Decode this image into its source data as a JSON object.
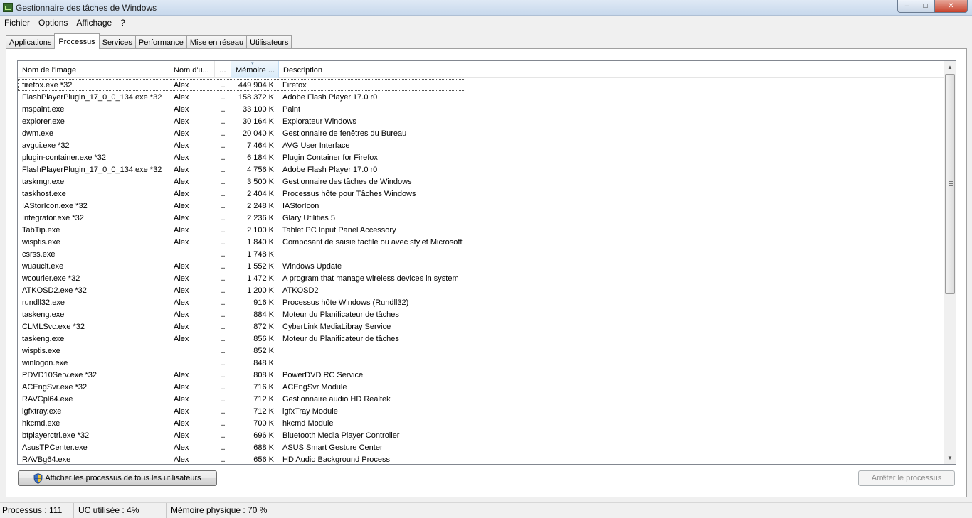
{
  "window": {
    "title": "Gestionnaire des tâches de Windows",
    "controls": {
      "minimize": "–",
      "maximize": "□",
      "close": "✕"
    }
  },
  "menu": [
    "Fichier",
    "Options",
    "Affichage",
    "?"
  ],
  "tabs": [
    {
      "label": "Applications",
      "active": false
    },
    {
      "label": "Processus",
      "active": true
    },
    {
      "label": "Services",
      "active": false
    },
    {
      "label": "Performance",
      "active": false
    },
    {
      "label": "Mise en réseau",
      "active": false
    },
    {
      "label": "Utilisateurs",
      "active": false
    }
  ],
  "columns": {
    "name": "Nom de l'image",
    "user": "Nom d'u...",
    "cpu": "...",
    "memory": "Mémoire ...",
    "description": "Description",
    "sort_arrow": "▾"
  },
  "processes": [
    {
      "name": "firefox.exe *32",
      "user": "Alex",
      "cpu": "..",
      "mem": "449 904 K",
      "desc": "Firefox"
    },
    {
      "name": "FlashPlayerPlugin_17_0_0_134.exe *32",
      "user": "Alex",
      "cpu": "..",
      "mem": "158 372 K",
      "desc": "Adobe Flash Player 17.0 r0"
    },
    {
      "name": "mspaint.exe",
      "user": "Alex",
      "cpu": "..",
      "mem": "33 100 K",
      "desc": "Paint"
    },
    {
      "name": "explorer.exe",
      "user": "Alex",
      "cpu": "..",
      "mem": "30 164 K",
      "desc": "Explorateur Windows"
    },
    {
      "name": "dwm.exe",
      "user": "Alex",
      "cpu": "..",
      "mem": "20 040 K",
      "desc": "Gestionnaire de fenêtres du Bureau"
    },
    {
      "name": "avgui.exe *32",
      "user": "Alex",
      "cpu": "..",
      "mem": "7 464 K",
      "desc": "AVG User Interface"
    },
    {
      "name": "plugin-container.exe *32",
      "user": "Alex",
      "cpu": "..",
      "mem": "6 184 K",
      "desc": "Plugin Container for Firefox"
    },
    {
      "name": "FlashPlayerPlugin_17_0_0_134.exe *32",
      "user": "Alex",
      "cpu": "..",
      "mem": "4 756 K",
      "desc": "Adobe Flash Player 17.0 r0"
    },
    {
      "name": "taskmgr.exe",
      "user": "Alex",
      "cpu": "..",
      "mem": "3 500 K",
      "desc": "Gestionnaire des tâches de Windows"
    },
    {
      "name": "taskhost.exe",
      "user": "Alex",
      "cpu": "..",
      "mem": "2 404 K",
      "desc": "Processus hôte pour Tâches Windows"
    },
    {
      "name": "IAStorIcon.exe *32",
      "user": "Alex",
      "cpu": "..",
      "mem": "2 248 K",
      "desc": "IAStorIcon"
    },
    {
      "name": "Integrator.exe *32",
      "user": "Alex",
      "cpu": "..",
      "mem": "2 236 K",
      "desc": "Glary Utilities 5"
    },
    {
      "name": "TabTip.exe",
      "user": "Alex",
      "cpu": "..",
      "mem": "2 100 K",
      "desc": "Tablet PC Input Panel Accessory"
    },
    {
      "name": "wisptis.exe",
      "user": "Alex",
      "cpu": "..",
      "mem": "1 840 K",
      "desc": "Composant de saisie tactile ou avec stylet Microsoft"
    },
    {
      "name": "csrss.exe",
      "user": "",
      "cpu": "..",
      "mem": "1 748 K",
      "desc": ""
    },
    {
      "name": "wuauclt.exe",
      "user": "Alex",
      "cpu": "..",
      "mem": "1 552 K",
      "desc": "Windows Update"
    },
    {
      "name": "wcourier.exe *32",
      "user": "Alex",
      "cpu": "..",
      "mem": "1 472 K",
      "desc": "A program that manage wireless devices in system"
    },
    {
      "name": "ATKOSD2.exe *32",
      "user": "Alex",
      "cpu": "..",
      "mem": "1 200 K",
      "desc": "ATKOSD2"
    },
    {
      "name": "rundll32.exe",
      "user": "Alex",
      "cpu": "..",
      "mem": "916 K",
      "desc": "Processus hôte Windows (Rundll32)"
    },
    {
      "name": "taskeng.exe",
      "user": "Alex",
      "cpu": "..",
      "mem": "884 K",
      "desc": "Moteur du Planificateur de tâches"
    },
    {
      "name": "CLMLSvc.exe *32",
      "user": "Alex",
      "cpu": "..",
      "mem": "872 K",
      "desc": "CyberLink MediaLibray Service"
    },
    {
      "name": "taskeng.exe",
      "user": "Alex",
      "cpu": "..",
      "mem": "856 K",
      "desc": "Moteur du Planificateur de tâches"
    },
    {
      "name": "wisptis.exe",
      "user": "",
      "cpu": "..",
      "mem": "852 K",
      "desc": ""
    },
    {
      "name": "winlogon.exe",
      "user": "",
      "cpu": "..",
      "mem": "848 K",
      "desc": ""
    },
    {
      "name": "PDVD10Serv.exe *32",
      "user": "Alex",
      "cpu": "..",
      "mem": "808 K",
      "desc": "PowerDVD RC Service"
    },
    {
      "name": "ACEngSvr.exe *32",
      "user": "Alex",
      "cpu": "..",
      "mem": "716 K",
      "desc": "ACEngSvr Module"
    },
    {
      "name": "RAVCpl64.exe",
      "user": "Alex",
      "cpu": "..",
      "mem": "712 K",
      "desc": "Gestionnaire audio HD Realtek"
    },
    {
      "name": "igfxtray.exe",
      "user": "Alex",
      "cpu": "..",
      "mem": "712 K",
      "desc": "igfxTray Module"
    },
    {
      "name": "hkcmd.exe",
      "user": "Alex",
      "cpu": "..",
      "mem": "700 K",
      "desc": "hkcmd Module"
    },
    {
      "name": "btplayerctrl.exe *32",
      "user": "Alex",
      "cpu": "..",
      "mem": "696 K",
      "desc": "Bluetooth Media Player Controller"
    },
    {
      "name": "AsusTPCenter.exe",
      "user": "Alex",
      "cpu": "..",
      "mem": "688 K",
      "desc": "ASUS Smart Gesture Center"
    },
    {
      "name": "RAVBg64.exe",
      "user": "Alex",
      "cpu": "..",
      "mem": "656 K",
      "desc": "HD Audio Background Process"
    }
  ],
  "buttons": {
    "show_all": "Afficher les processus de tous les utilisateurs",
    "end_process": "Arrêter le processus"
  },
  "status": {
    "processes": "Processus : 111",
    "cpu": "UC utilisée : 4%",
    "memory": "Mémoire physique : 70 %"
  },
  "scrollbar": {
    "up": "▲",
    "down": "▼"
  },
  "colors": {
    "selected_header": "#d9ebf9",
    "close_button": "#c7422c",
    "titlebar": "#c7d8ec"
  }
}
